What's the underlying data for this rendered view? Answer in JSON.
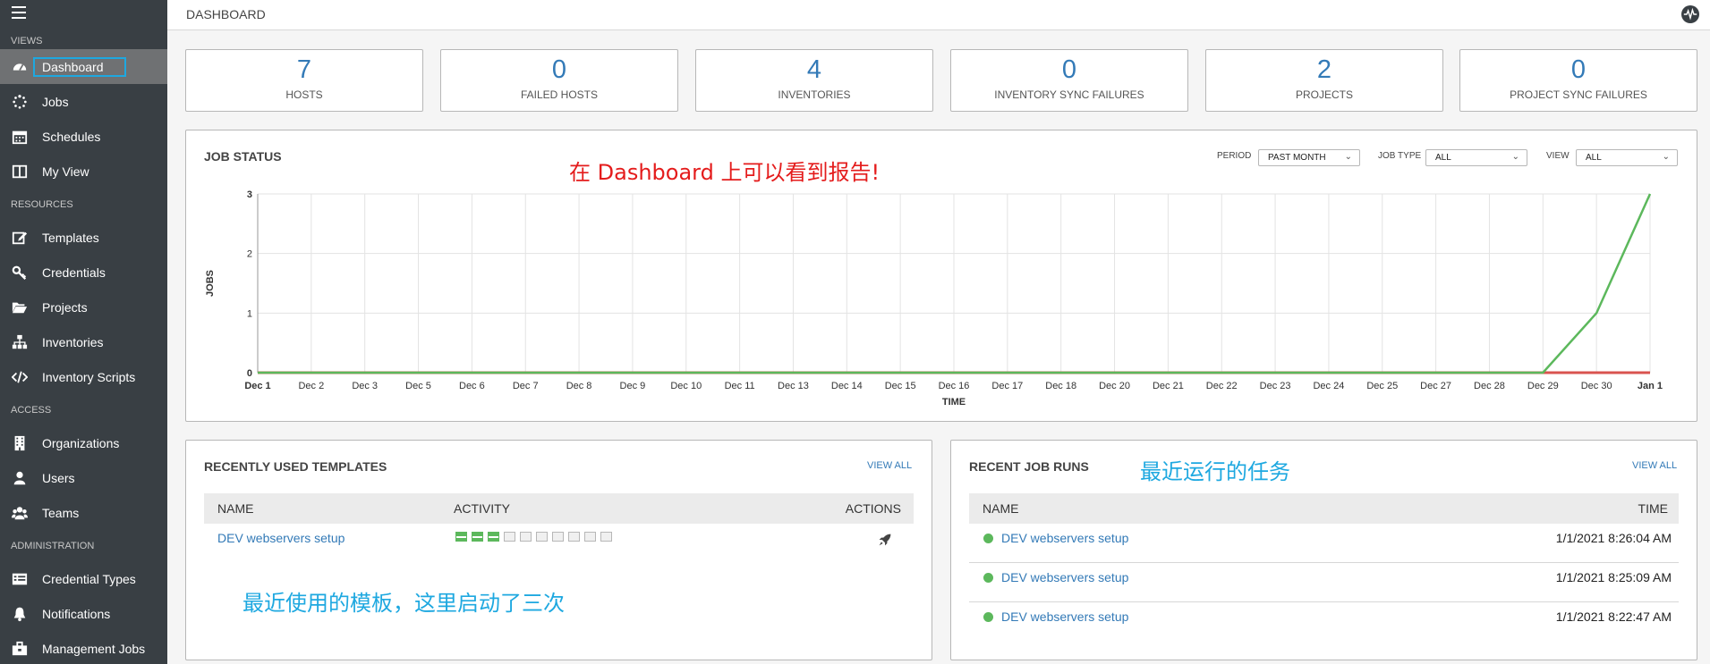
{
  "sidebar": {
    "sections": {
      "views": "VIEWS",
      "resources": "RESOURCES",
      "access": "ACCESS",
      "administration": "ADMINISTRATION"
    },
    "items": {
      "dashboard": "Dashboard",
      "jobs": "Jobs",
      "schedules": "Schedules",
      "my_view": "My View",
      "templates": "Templates",
      "credentials": "Credentials",
      "projects": "Projects",
      "inventories": "Inventories",
      "inventory_scripts": "Inventory Scripts",
      "organizations": "Organizations",
      "users": "Users",
      "teams": "Teams",
      "credential_types": "Credential Types",
      "notifications": "Notifications",
      "management_jobs": "Management Jobs"
    }
  },
  "header": {
    "title": "DASHBOARD"
  },
  "cards": [
    {
      "value": "7",
      "label": "HOSTS"
    },
    {
      "value": "0",
      "label": "FAILED HOSTS"
    },
    {
      "value": "4",
      "label": "INVENTORIES"
    },
    {
      "value": "0",
      "label": "INVENTORY SYNC FAILURES"
    },
    {
      "value": "2",
      "label": "PROJECTS"
    },
    {
      "value": "0",
      "label": "PROJECT SYNC FAILURES"
    }
  ],
  "job_status": {
    "title": "JOB STATUS",
    "annotation": "在 Dashboard 上可以看到报告!",
    "filters": {
      "period_label": "PERIOD",
      "period_value": "PAST MONTH",
      "job_type_label": "JOB TYPE",
      "job_type_value": "ALL",
      "view_label": "VIEW",
      "view_value": "ALL"
    }
  },
  "chart_data": {
    "type": "line",
    "title": "JOB STATUS",
    "xlabel": "TIME",
    "ylabel": "JOBS",
    "ylim": [
      0,
      3
    ],
    "yticks": [
      "0",
      "1",
      "2",
      "3"
    ],
    "categories": [
      "Dec 1",
      "Dec 2",
      "Dec 3",
      "Dec 5",
      "Dec 6",
      "Dec 7",
      "Dec 8",
      "Dec 9",
      "Dec 10",
      "Dec 11",
      "Dec 13",
      "Dec 14",
      "Dec 15",
      "Dec 16",
      "Dec 17",
      "Dec 18",
      "Dec 20",
      "Dec 21",
      "Dec 22",
      "Dec 23",
      "Dec 24",
      "Dec 25",
      "Dec 27",
      "Dec 28",
      "Dec 29",
      "Dec 30",
      "Jan 1"
    ],
    "grid": true,
    "series": [
      {
        "color": "#5cb85c",
        "x": [
          "Dec 1",
          "Dec 29",
          "Dec 30",
          "Jan 1"
        ],
        "values": [
          0,
          0,
          1,
          3
        ]
      },
      {
        "color": "#d9534f",
        "x": [
          "Dec 1",
          "Jan 1"
        ],
        "values": [
          0,
          0
        ]
      }
    ]
  },
  "templates": {
    "title": "RECENTLY USED TEMPLATES",
    "view_all": "VIEW ALL",
    "columns": {
      "name": "NAME",
      "activity": "ACTIVITY",
      "actions": "ACTIONS"
    },
    "rows": [
      {
        "name": "DEV webservers setup",
        "activity": [
          "ok",
          "ok",
          "ok",
          "none",
          "none",
          "none",
          "none",
          "none",
          "none",
          "none"
        ]
      }
    ],
    "annotation": "最近使用的模板，这里启动了三次"
  },
  "job_runs": {
    "title": "RECENT JOB RUNS",
    "view_all": "VIEW ALL",
    "annotation": "最近运行的任务",
    "columns": {
      "name": "NAME",
      "time": "TIME"
    },
    "rows": [
      {
        "name": "DEV webservers setup",
        "time": "1/1/2021 8:26:04 AM"
      },
      {
        "name": "DEV webservers setup",
        "time": "1/1/2021 8:25:09 AM"
      },
      {
        "name": "DEV webservers setup",
        "time": "1/1/2021 8:22:47 AM"
      }
    ]
  },
  "colors": {
    "sidebar": "#393f44",
    "active": "#6f7173",
    "link": "#337ab7",
    "success": "#5cb85c",
    "fail": "#d9534f",
    "annot_red": "#e41c1c",
    "annot_blue": "#1ea8e0"
  }
}
